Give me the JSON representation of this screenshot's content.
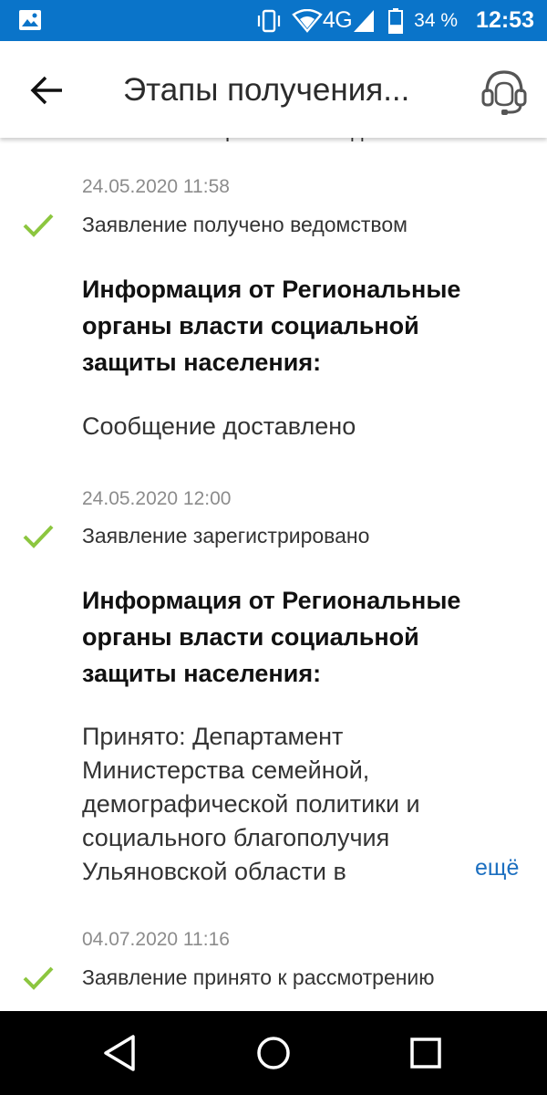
{
  "status_bar": {
    "network": "4G",
    "battery": "34 %",
    "battery_level": 0.34,
    "time": "12:53"
  },
  "app_bar": {
    "title": "Этапы получения...",
    "back_icon": "arrow-left-icon",
    "support_icon": "headset-icon"
  },
  "events": [
    {
      "date": "24.05.2020 11:58",
      "status": "Заявление получено ведомством",
      "info_title": "Информация от Региональные органы власти социальной защиты населения:",
      "info_body": "Сообщение доставлено"
    },
    {
      "date": "24.05.2020 12:00",
      "status": "Заявление зарегистрировано",
      "info_title": "Информация от Региональные органы власти социальной защиты населения:",
      "info_body": "Принято: Департамент Министерства семейной, демографической политики и социального благополучия Ульяновской области в",
      "more": "ещё"
    },
    {
      "date": "04.07.2020 11:16",
      "status": "Заявление принято к рассмотрению"
    }
  ],
  "colors": {
    "status_bar": "#0a74c9",
    "check": "#8cc63f",
    "link": "#1c6fc0"
  }
}
